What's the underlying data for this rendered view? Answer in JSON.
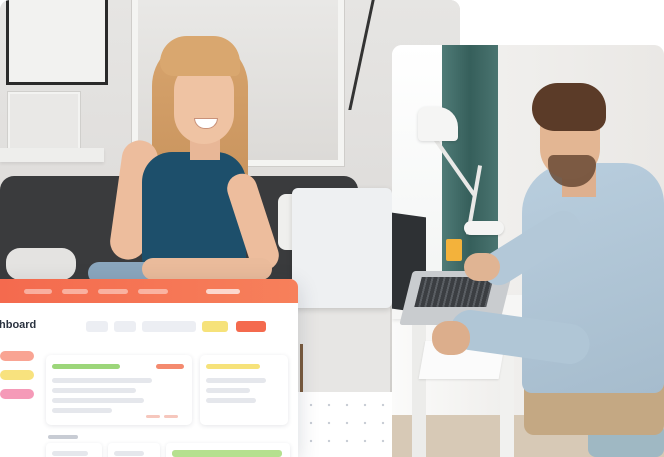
{
  "dashboard": {
    "title_fragment": "hboard"
  },
  "colors": {
    "accent": "#f46a4e",
    "yellow": "#f6e27a",
    "green": "#9cd67a",
    "pink": "#f59ab8"
  },
  "images": {
    "photo_left": "woman-smiling-laptop-photo",
    "photo_right": "man-writing-desk-photo"
  }
}
